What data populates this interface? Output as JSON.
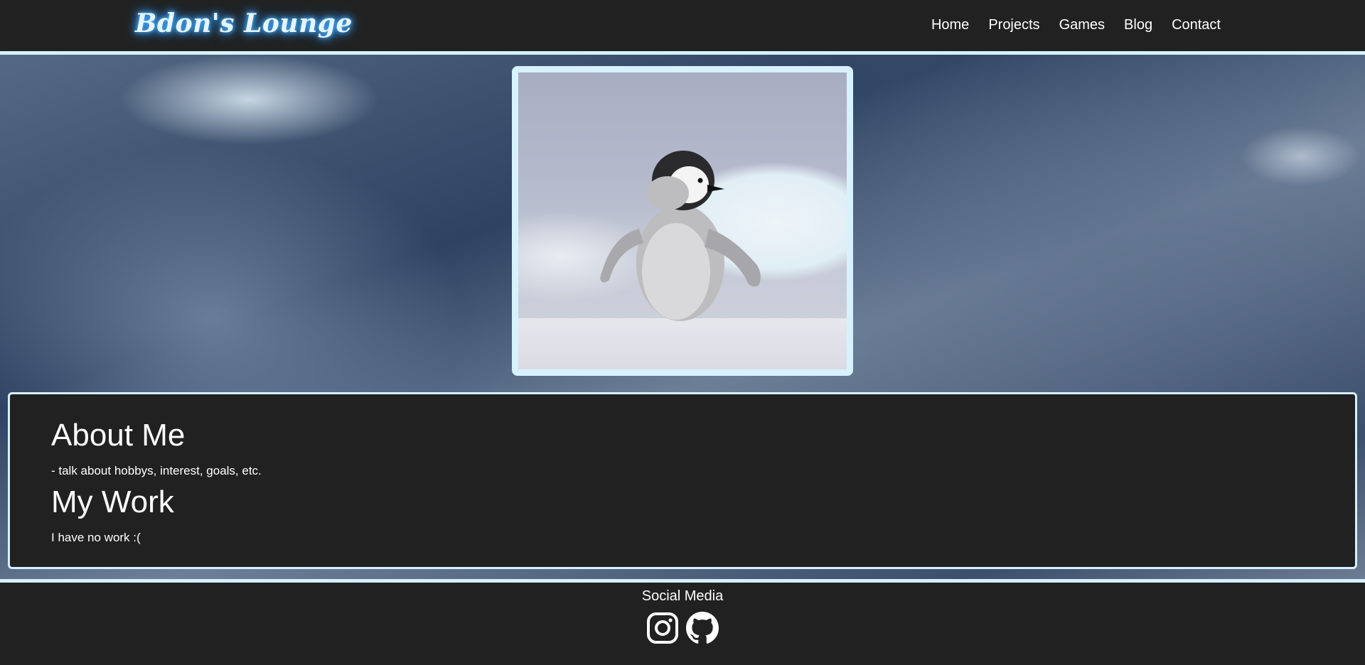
{
  "header": {
    "logo": "Bdon's Lounge",
    "nav": [
      "Home",
      "Projects",
      "Games",
      "Blog",
      "Contact"
    ]
  },
  "hero": {
    "image_subject": "baby penguin on snow"
  },
  "content": {
    "about_title": "About Me",
    "about_text": "- talk about hobbys, interest, goals, etc.",
    "work_title": "My Work",
    "work_text": "I have no work :("
  },
  "footer": {
    "title": "Social Media",
    "icons": [
      "instagram-icon",
      "github-icon"
    ]
  },
  "colors": {
    "bar": "#212121",
    "accent_border": "#d6f0ff",
    "logo_glow": "#3aa0ff"
  }
}
